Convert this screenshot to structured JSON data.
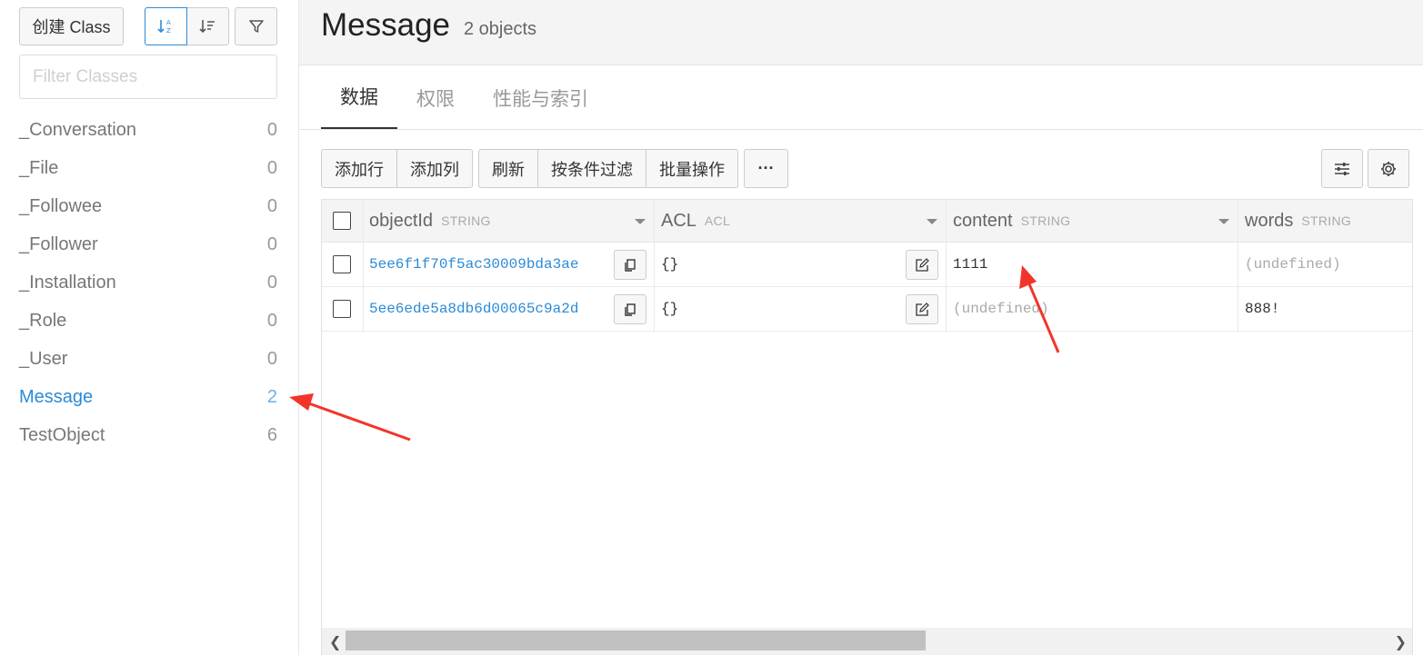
{
  "sidebar": {
    "create_label": "创建 Class",
    "filter_placeholder": "Filter Classes",
    "classes": [
      {
        "name": "_Conversation",
        "count": "0"
      },
      {
        "name": "_File",
        "count": "0"
      },
      {
        "name": "_Followee",
        "count": "0"
      },
      {
        "name": "_Follower",
        "count": "0"
      },
      {
        "name": "_Installation",
        "count": "0"
      },
      {
        "name": "_Role",
        "count": "0"
      },
      {
        "name": "_User",
        "count": "0"
      },
      {
        "name": "Message",
        "count": "2"
      },
      {
        "name": "TestObject",
        "count": "6"
      }
    ]
  },
  "header": {
    "title": "Message",
    "subtitle": "2 objects"
  },
  "tabs": [
    "数据",
    "权限",
    "性能与索引"
  ],
  "toolbar": {
    "add_row": "添加行",
    "add_column": "添加列",
    "refresh": "刷新",
    "filter": "按条件过滤",
    "batch": "批量操作",
    "more": "···"
  },
  "table": {
    "columns": [
      {
        "name": "objectId",
        "type": "STRING"
      },
      {
        "name": "ACL",
        "type": "ACL"
      },
      {
        "name": "content",
        "type": "STRING"
      },
      {
        "name": "words",
        "type": "STRING"
      }
    ],
    "rows": [
      {
        "objectId": "5ee6f1f70f5ac30009bda3ae",
        "acl": "{}",
        "content": "1111",
        "words": "(undefined)"
      },
      {
        "objectId": "5ee6ede5a8db6d00065c9a2d",
        "acl": "{}",
        "content": "(undefined)",
        "words": "888!"
      }
    ]
  },
  "colors": {
    "accent": "#2b8bd8",
    "annotation": "#f2352a"
  }
}
